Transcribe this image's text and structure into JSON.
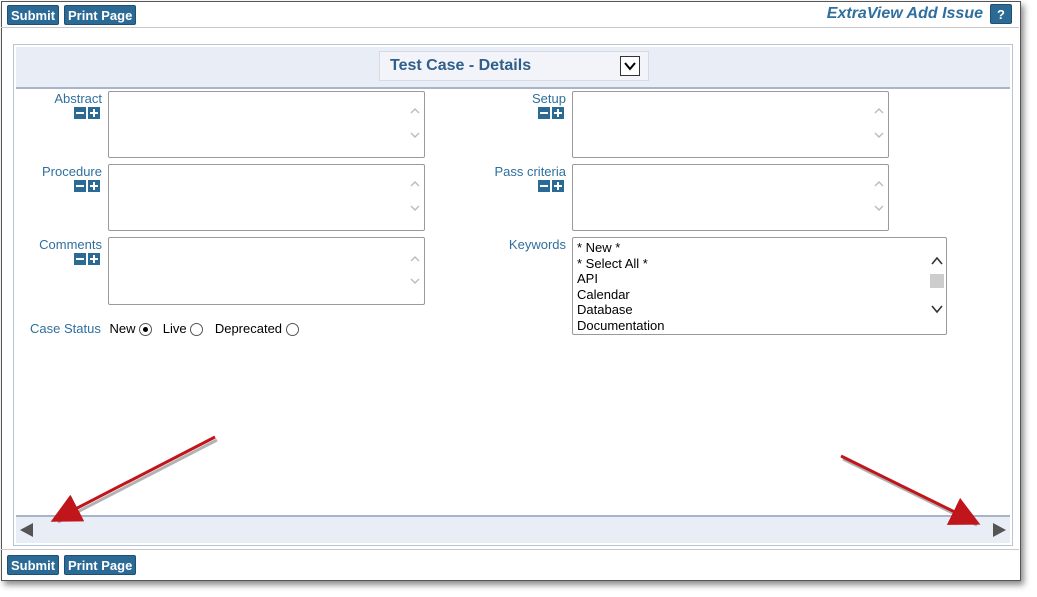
{
  "header": {
    "submit_label": "Submit",
    "print_label": "Print Page",
    "title": "ExtraView Add Issue",
    "help_label": "?"
  },
  "layout_tab": {
    "label": "Test Case - Details"
  },
  "fields": {
    "abstract": {
      "label": "Abstract",
      "value": ""
    },
    "setup": {
      "label": "Setup",
      "value": ""
    },
    "procedure": {
      "label": "Procedure",
      "value": ""
    },
    "pass_criteria": {
      "label": "Pass criteria",
      "value": ""
    },
    "comments": {
      "label": "Comments",
      "value": ""
    },
    "keywords": {
      "label": "Keywords",
      "options": [
        "* New *",
        "* Select All *",
        "API",
        "Calendar",
        "Database",
        "Documentation"
      ]
    },
    "case_status": {
      "label": "Case Status",
      "options": [
        {
          "label": "New",
          "selected": true
        },
        {
          "label": "Live",
          "selected": false
        },
        {
          "label": "Deprecated",
          "selected": false
        }
      ]
    }
  },
  "footer": {
    "submit_label": "Submit",
    "print_label": "Print Page"
  },
  "colors": {
    "accent": "#2c6a96",
    "label": "#2f6f9e",
    "annotation_arrow": "#c0161b"
  }
}
